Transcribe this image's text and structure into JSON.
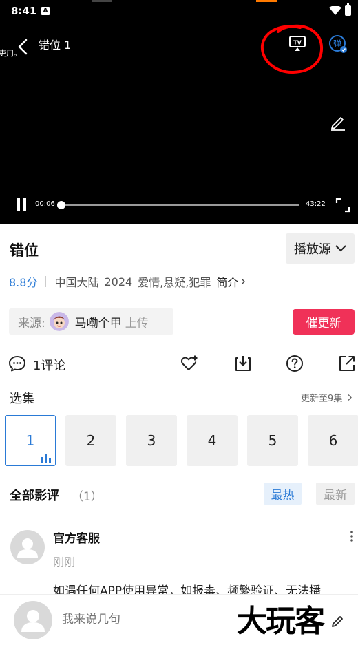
{
  "status_bar": {
    "time": "8:41",
    "notification_icon": "A"
  },
  "player": {
    "left_snippet": "吏用。",
    "title": "错位 1",
    "current_time": "00:06",
    "total_time": "43:22",
    "progress_fraction": 0.002,
    "danmu_label": "弹",
    "tv_label": "TV",
    "annotation_color": "#ff0000"
  },
  "detail": {
    "title": "错位",
    "source_button": "播放源",
    "score": "8.8分",
    "region": "中国大陆",
    "year": "2024",
    "genres": "爱情,悬疑,犯罪",
    "intro_link": "简介",
    "uploader_prefix": "来源:",
    "uploader_name": "马嘞个甲",
    "uploader_suffix": "上传",
    "urge_button": "催更新"
  },
  "actions": {
    "comment_count": "1评论",
    "icons": [
      "comment-icon",
      "favorite-add-icon",
      "download-icon",
      "help-icon",
      "share-icon"
    ]
  },
  "episodes": {
    "label": "选集",
    "update_text": "更新至9集",
    "items": [
      "1",
      "2",
      "3",
      "4",
      "5",
      "6"
    ],
    "active_index": 0
  },
  "reviews": {
    "title": "全部影评",
    "count": "（1）",
    "sort_hot": "最热",
    "sort_new": "最新",
    "item": {
      "author": "官方客服",
      "time": "刚刚",
      "text": "如遇任何APP使用异常，如报毒、频繁验证、无法播"
    }
  },
  "bottom_bar": {
    "placeholder": "我来说几句",
    "watermark": "大玩客"
  },
  "colors": {
    "accent": "#2a7ad6",
    "urge": "#f03158"
  }
}
